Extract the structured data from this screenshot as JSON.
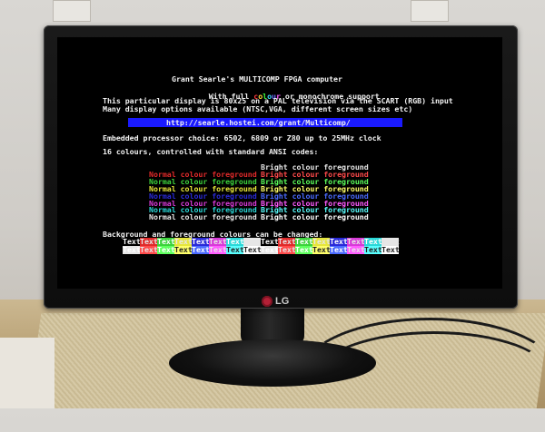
{
  "screen": {
    "title_line1": "Grant Searle's MULTICOMP FPGA computer",
    "title_line2_prefix": "With full ",
    "title_line2_colour": [
      "c",
      "o",
      "l",
      "o",
      "u",
      "r"
    ],
    "title_line2_suffix": " or monochrome support",
    "display_line1": "This particular display is 80x25 on a PAL television via the SCART (RGB) input",
    "display_line2": "Many display options available (NTSC,VGA, different screen sizes etc)",
    "url": "http://searle.hostei.com/grant/Multicomp/",
    "processor_line": "Embedded processor choice: 6502, 6809 or Z80 up to 25MHz clock",
    "colours_line": "16 colours, controlled with standard ANSI codes:",
    "normal_label": "Normal colour foreground",
    "bright_label": "Bright colour foreground",
    "bg_line": "Background and foreground colours can be changed:",
    "text_token": "Text"
  },
  "monitor": {
    "brand": "LG"
  },
  "colors": {
    "normal": [
      "#000000",
      "#e02a2a",
      "#3cd23c",
      "#e6e63a",
      "#2a2ad8",
      "#d83ad8",
      "#2ad8d8",
      "#e6e6e6"
    ],
    "bright": [
      "#e6e6e6",
      "#ff4a4a",
      "#5cff5c",
      "#ffff6a",
      "#4a6aff",
      "#ff5aff",
      "#5affff",
      "#ffffff"
    ],
    "colour_word": [
      "#ff3a3a",
      "#ffd83a",
      "#3aff3a",
      "#3adcff",
      "#6a6aff",
      "#ff5aff"
    ]
  }
}
